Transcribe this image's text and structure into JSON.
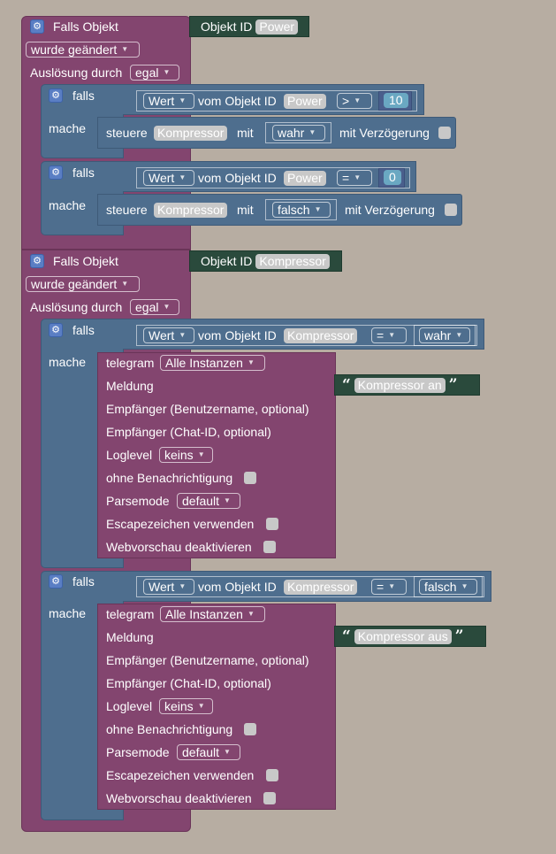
{
  "labels": {
    "falls_objekt": "Falls Objekt",
    "objekt_id": "Objekt ID",
    "ausloesung": "Auslösung durch",
    "falls": "falls",
    "mache": "mache",
    "steuere": "steuere",
    "mit": "mit",
    "mit_verzoegerung": "mit Verzögerung",
    "vom_objekt_id": "vom Objekt ID",
    "telegram": "telegram",
    "meldung": "Meldung",
    "empfaenger_user": "Empfänger (Benutzername, optional)",
    "empfaenger_chat": "Empfänger (Chat-ID, optional)",
    "loglevel": "Loglevel",
    "ohne_benachrichtigung": "ohne Benachrichtigung",
    "parsemode": "Parsemode",
    "escapezeichen": "Escapezeichen verwenden",
    "webvorschau": "Webvorschau deaktivieren"
  },
  "trigger1": {
    "object_id": "Power",
    "change_mode": "wurde geändert",
    "trigger_by": "egal",
    "if1": {
      "property": "Wert",
      "object": "Power",
      "operator": ">",
      "value": "10",
      "target": "Kompressor",
      "set_value": "wahr"
    },
    "if2": {
      "property": "Wert",
      "object": "Power",
      "operator": "=",
      "value": "0",
      "target": "Kompressor",
      "set_value": "falsch"
    }
  },
  "trigger2": {
    "object_id": "Kompressor",
    "change_mode": "wurde geändert",
    "trigger_by": "egal",
    "if1": {
      "property": "Wert",
      "object": "Kompressor",
      "operator": "=",
      "value": "wahr",
      "telegram_instance": "Alle Instanzen",
      "message": "Kompressor an",
      "loglevel": "keins",
      "parsemode": "default"
    },
    "if2": {
      "property": "Wert",
      "object": "Kompressor",
      "operator": "=",
      "value": "falsch",
      "telegram_instance": "Alle Instanzen",
      "message": "Kompressor aus",
      "loglevel": "keins",
      "parsemode": "default"
    }
  },
  "icons": {
    "gear": "gear-icon",
    "dropdown": "chevron-down-icon",
    "quote_open": "“",
    "quote_close": "”"
  },
  "colors": {
    "background": "#b7ada2",
    "trigger_block": "#83456f",
    "logic_block": "#4e6e8e",
    "object_block": "#2a4a3c"
  }
}
